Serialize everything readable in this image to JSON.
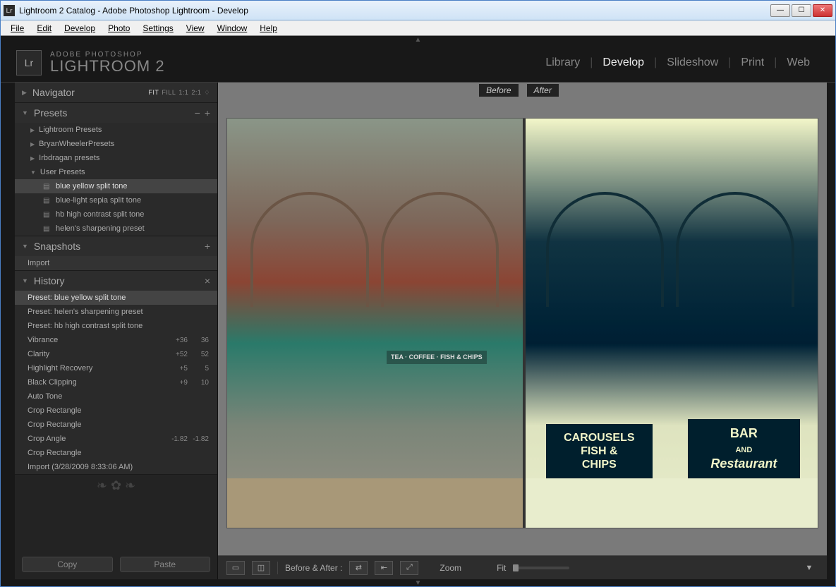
{
  "window": {
    "title": "Lightroom 2 Catalog - Adobe Photoshop Lightroom - Develop"
  },
  "menubar": [
    "File",
    "Edit",
    "Develop",
    "Photo",
    "Settings",
    "View",
    "Window",
    "Help"
  ],
  "app": {
    "badge": "Lr",
    "subtitle": "ADOBE PHOTOSHOP",
    "title": "LIGHTROOM 2"
  },
  "modules": [
    "Library",
    "Develop",
    "Slideshow",
    "Print",
    "Web"
  ],
  "modules_active": "Develop",
  "navigator": {
    "title": "Navigator",
    "modes": [
      "FIT",
      "FILL",
      "1:1",
      "2:1"
    ],
    "active": "FIT"
  },
  "presets": {
    "title": "Presets",
    "groups": [
      {
        "label": "Lightroom Presets",
        "open": false
      },
      {
        "label": "BryanWheelerPresets",
        "open": false
      },
      {
        "label": "Irbdragan presets",
        "open": false
      },
      {
        "label": "User Presets",
        "open": true
      }
    ],
    "user_items": [
      "blue yellow split tone",
      "blue-light sepia split tone",
      "hb high contrast split tone",
      "helen's sharpening preset"
    ],
    "active": "blue yellow split tone"
  },
  "snapshots": {
    "title": "Snapshots",
    "items": [
      "Import"
    ]
  },
  "history": {
    "title": "History",
    "items": [
      {
        "label": "Preset: blue yellow split tone",
        "v1": "",
        "v2": "",
        "active": true
      },
      {
        "label": "Preset: helen's sharpening preset",
        "v1": "",
        "v2": ""
      },
      {
        "label": "Preset: hb high contrast split tone",
        "v1": "",
        "v2": ""
      },
      {
        "label": "Vibrance",
        "v1": "+36",
        "v2": "36"
      },
      {
        "label": "Clarity",
        "v1": "+52",
        "v2": "52"
      },
      {
        "label": "Highlight Recovery",
        "v1": "+5",
        "v2": "5"
      },
      {
        "label": "Black Clipping",
        "v1": "+9",
        "v2": "10"
      },
      {
        "label": "Auto Tone",
        "v1": "",
        "v2": ""
      },
      {
        "label": "Crop Rectangle",
        "v1": "",
        "v2": ""
      },
      {
        "label": "Crop Rectangle",
        "v1": "",
        "v2": ""
      },
      {
        "label": "Crop Angle",
        "v1": "-1.82",
        "v2": "-1.82"
      },
      {
        "label": "Crop Rectangle",
        "v1": "",
        "v2": ""
      },
      {
        "label": "Import (3/28/2009 8:33:06 AM)",
        "v1": "",
        "v2": ""
      }
    ]
  },
  "footer": {
    "copy": "Copy",
    "paste": "Paste"
  },
  "compare": {
    "before": "Before",
    "after": "After"
  },
  "signs": {
    "carousel": "CAROUSELS\nFISH &\nCHIPS",
    "bar": "BAR\nAND\nRestaurant",
    "awning": "TEA · COFFEE · FISH & CHIPS"
  },
  "toolbar": {
    "ba_label": "Before & After :",
    "zoom": "Zoom",
    "fit": "Fit"
  }
}
